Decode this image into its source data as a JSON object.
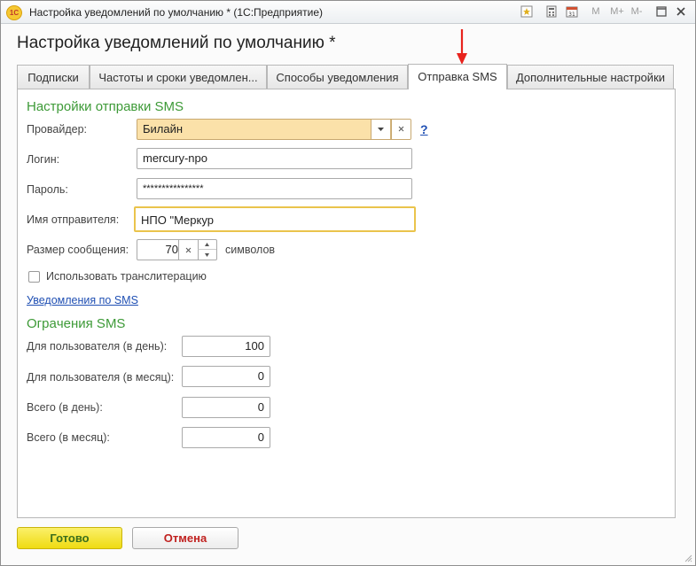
{
  "window": {
    "title": "Настройка уведомлений по умолчанию * (1С:Предприятие)",
    "toolbar": {
      "m": "M",
      "m_plus": "M+",
      "m_minus": "M-"
    }
  },
  "heading": "Настройка уведомлений по умолчанию *",
  "tabs": [
    {
      "label": "Подписки"
    },
    {
      "label": "Частоты и сроки уведомлен..."
    },
    {
      "label": "Способы уведомления"
    },
    {
      "label": "Отправка SMS",
      "active": true
    },
    {
      "label": "Дополнительные настройки"
    }
  ],
  "sms": {
    "section_title": "Настройки отправки SMS",
    "provider": {
      "label": "Провайдер:",
      "value": "Билайн",
      "help": "?"
    },
    "login": {
      "label": "Логин:",
      "value": "mercury-npo"
    },
    "password": {
      "label": "Пароль:",
      "value": "****************"
    },
    "sender": {
      "label": "Имя отправителя:",
      "value": "НПО \"Меркур"
    },
    "msg_size": {
      "label": "Размер сообщения:",
      "value": "70",
      "unit": "символов"
    },
    "translit": {
      "label": "Использовать транслитерацию",
      "checked": false
    },
    "link": "Уведомления по SMS"
  },
  "limits": {
    "section_title": "Огрaчения SMS",
    "rows": [
      {
        "label": "Для пользователя (в день):",
        "value": "100"
      },
      {
        "label": "Для пользователя (в месяц):",
        "value": "0"
      },
      {
        "label": "Всего (в день):",
        "value": "0"
      },
      {
        "label": "Всего (в месяц):",
        "value": "0"
      }
    ]
  },
  "footer": {
    "ok": "Готово",
    "cancel": "Отмена"
  },
  "colors": {
    "accent_green": "#3d9a37",
    "annotation_arrow": "#e8231d",
    "ok_button": "#f1e21a",
    "cancel_text": "#c0211f"
  }
}
